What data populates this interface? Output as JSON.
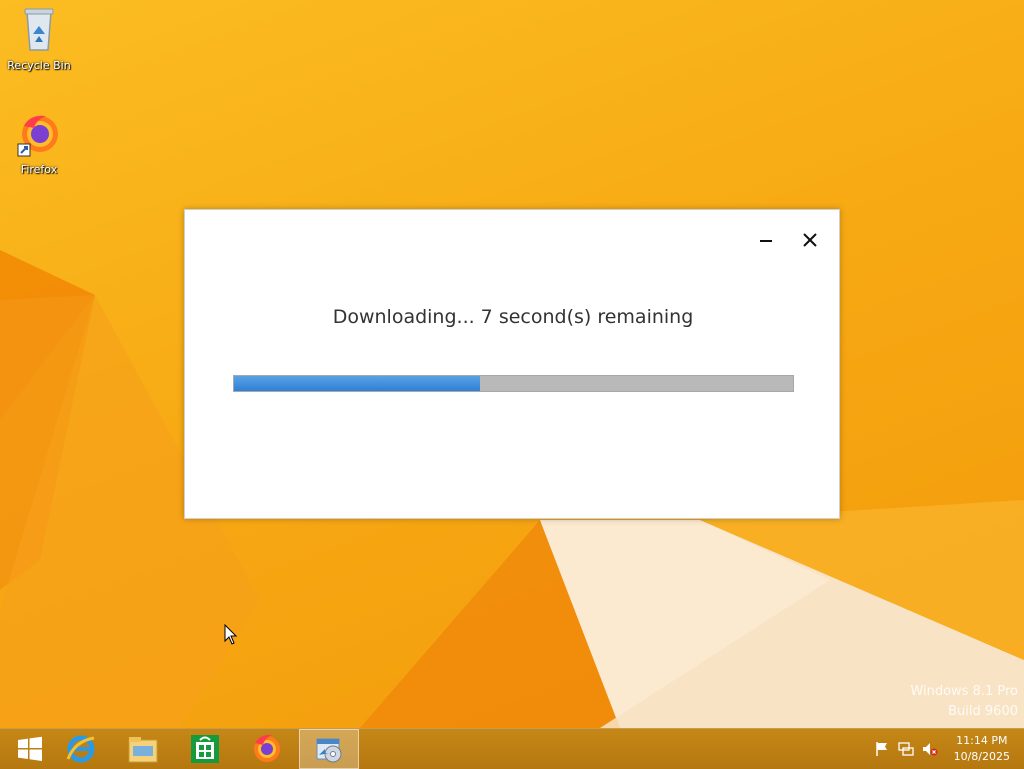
{
  "desktop": {
    "icons": [
      {
        "label": "Recycle Bin",
        "icon": "recycle-bin-icon"
      },
      {
        "label": "Firefox",
        "icon": "firefox-icon"
      }
    ],
    "watermark": {
      "line1": "Windows 8.1 Pro",
      "line2": "Build 9600"
    }
  },
  "dialog": {
    "message": "Downloading... 7 second(s) remaining",
    "progress": 0.44,
    "minimize_icon": "minimize-icon",
    "close_icon": "close-icon"
  },
  "taskbar": {
    "buttons": [
      {
        "icon": "windows-start-icon"
      },
      {
        "icon": "internet-explorer-icon"
      },
      {
        "icon": "file-explorer-icon"
      },
      {
        "icon": "store-icon"
      },
      {
        "icon": "firefox-icon"
      },
      {
        "icon": "installer-app-icon",
        "active": true
      }
    ],
    "tray": [
      "flag-icon",
      "network-icon",
      "speaker-muted-icon"
    ],
    "clock": {
      "time": "11:14 PM",
      "date": "10/8/2025"
    }
  },
  "colors": {
    "wallpaper": "#f7aa14",
    "progress_fill": "#3a8ad8",
    "progress_track": "#b9b9b9",
    "taskbar": "#bd7f13"
  }
}
